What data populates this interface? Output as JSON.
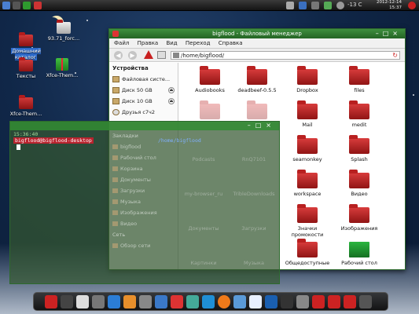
{
  "top_panel": {
    "temperature": "-13 C",
    "clock_date": "2012-12-14",
    "clock_time": "15:37"
  },
  "desktop_icons": [
    {
      "label": "Домашний каталог"
    },
    {
      "label": "93.71_forc..."
    },
    {
      "label": "Тексты"
    },
    {
      "label": "Xfce-Them..."
    },
    {
      "label": "Xfce-Them..."
    }
  ],
  "file_manager": {
    "title": "bigflood - Файловый менеджер",
    "menu": [
      "Файл",
      "Правка",
      "Вид",
      "Переход",
      "Справка"
    ],
    "address": "/home/bigflood/",
    "sidebar_header": "Устройства",
    "devices": [
      {
        "label": "Файловая систе..."
      },
      {
        "label": "Диск 50 GB"
      },
      {
        "label": "Диск 10 GB"
      },
      {
        "label": "Друзья с7ч2"
      }
    ],
    "items": [
      {
        "label": "Audiobooks"
      },
      {
        "label": "deadbeef-0.5.5"
      },
      {
        "label": "Dropbox"
      },
      {
        "label": "files"
      },
      {
        "label": "Mail"
      },
      {
        "label": "medit"
      },
      {
        "label": "seamonkey"
      },
      {
        "label": "Splash"
      },
      {
        "label": "workspace"
      },
      {
        "label": "Видео"
      },
      {
        "label": "Значки промокости"
      },
      {
        "label": "Изображения"
      },
      {
        "label": "Общедоступные"
      },
      {
        "label": "Рабочий стол"
      }
    ],
    "faded_items": [
      {
        "label": "Podcasts"
      },
      {
        "label": "RnQ7101"
      },
      {
        "label": "my-browser_ru"
      },
      {
        "label": "TribleDownloads"
      },
      {
        "label": "Документы"
      },
      {
        "label": "Загрузки"
      },
      {
        "label": "Картинки"
      },
      {
        "label": "Музыка"
      }
    ]
  },
  "terminal": {
    "time": "15:36:40",
    "prompt": "bigflood@bigflood-desktop",
    "path": "/home/bigflood",
    "overlay_header": "Закладки",
    "overlay_items": [
      "bigflood",
      "Рабочий стол",
      "Корзина",
      "Документы",
      "Загрузки",
      "Музыка",
      "Изображения",
      "Видео"
    ],
    "overlay_net_header": "Сеть",
    "overlay_net_item": "Обзор сети"
  },
  "colors": {
    "accent_green": "#2f7f2f",
    "folder_red": "#c02424"
  }
}
